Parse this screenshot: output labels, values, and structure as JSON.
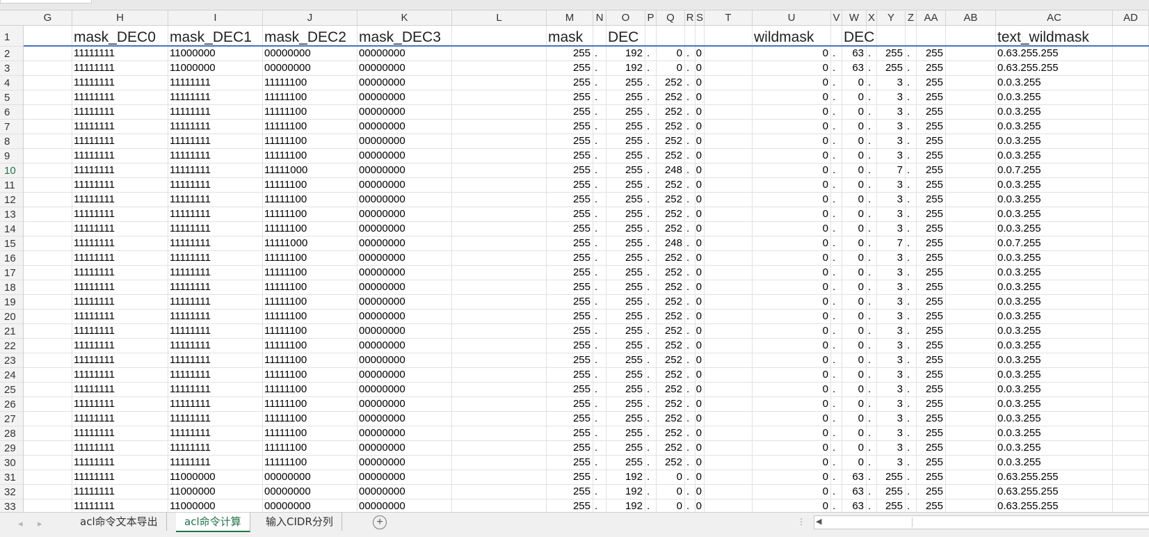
{
  "column_headers": [
    "G",
    "H",
    "I",
    "J",
    "K",
    "L",
    "M",
    "N",
    "O",
    "P",
    "Q",
    "R",
    "S",
    "T",
    "U",
    "V",
    "W",
    "X",
    "Y",
    "Z",
    "AA",
    "AB",
    "AC",
    "AD"
  ],
  "row_numbers": [
    "1",
    "2",
    "3",
    "4",
    "5",
    "6",
    "7",
    "8",
    "9",
    "10",
    "11",
    "12",
    "13",
    "14",
    "15",
    "16",
    "17",
    "18",
    "19",
    "20",
    "21",
    "22",
    "23",
    "24",
    "25",
    "26",
    "27",
    "28",
    "29",
    "30",
    "31",
    "32",
    "33"
  ],
  "selected_row": "10",
  "header_row": {
    "H": "mask_DEC0",
    "I": "mask_DEC1",
    "J": "mask_DEC2",
    "K": "mask_DEC3",
    "M": "mask",
    "O": "DEC",
    "U": "wildmask",
    "W": "DEC",
    "AC": "text_wildmask"
  },
  "rows": [
    {
      "H": "11111111",
      "I": "11000000",
      "J": "00000000",
      "K": "00000000",
      "M": "255",
      "O": "192",
      "Q": "0",
      "S": "0",
      "U": "0",
      "W": "63",
      "Y": "255",
      "AA": "255",
      "AC": "0.63.255.255"
    },
    {
      "H": "11111111",
      "I": "11000000",
      "J": "00000000",
      "K": "00000000",
      "M": "255",
      "O": "192",
      "Q": "0",
      "S": "0",
      "U": "0",
      "W": "63",
      "Y": "255",
      "AA": "255",
      "AC": "0.63.255.255"
    },
    {
      "H": "11111111",
      "I": "11111111",
      "J": "11111100",
      "K": "00000000",
      "M": "255",
      "O": "255",
      "Q": "252",
      "S": "0",
      "U": "0",
      "W": "0",
      "Y": "3",
      "AA": "255",
      "AC": "0.0.3.255"
    },
    {
      "H": "11111111",
      "I": "11111111",
      "J": "11111100",
      "K": "00000000",
      "M": "255",
      "O": "255",
      "Q": "252",
      "S": "0",
      "U": "0",
      "W": "0",
      "Y": "3",
      "AA": "255",
      "AC": "0.0.3.255"
    },
    {
      "H": "11111111",
      "I": "11111111",
      "J": "11111100",
      "K": "00000000",
      "M": "255",
      "O": "255",
      "Q": "252",
      "S": "0",
      "U": "0",
      "W": "0",
      "Y": "3",
      "AA": "255",
      "AC": "0.0.3.255"
    },
    {
      "H": "11111111",
      "I": "11111111",
      "J": "11111100",
      "K": "00000000",
      "M": "255",
      "O": "255",
      "Q": "252",
      "S": "0",
      "U": "0",
      "W": "0",
      "Y": "3",
      "AA": "255",
      "AC": "0.0.3.255"
    },
    {
      "H": "11111111",
      "I": "11111111",
      "J": "11111100",
      "K": "00000000",
      "M": "255",
      "O": "255",
      "Q": "252",
      "S": "0",
      "U": "0",
      "W": "0",
      "Y": "3",
      "AA": "255",
      "AC": "0.0.3.255"
    },
    {
      "H": "11111111",
      "I": "11111111",
      "J": "11111100",
      "K": "00000000",
      "M": "255",
      "O": "255",
      "Q": "252",
      "S": "0",
      "U": "0",
      "W": "0",
      "Y": "3",
      "AA": "255",
      "AC": "0.0.3.255"
    },
    {
      "H": "11111111",
      "I": "11111111",
      "J": "11111000",
      "K": "00000000",
      "M": "255",
      "O": "255",
      "Q": "248",
      "S": "0",
      "U": "0",
      "W": "0",
      "Y": "7",
      "AA": "255",
      "AC": "0.0.7.255"
    },
    {
      "H": "11111111",
      "I": "11111111",
      "J": "11111100",
      "K": "00000000",
      "M": "255",
      "O": "255",
      "Q": "252",
      "S": "0",
      "U": "0",
      "W": "0",
      "Y": "3",
      "AA": "255",
      "AC": "0.0.3.255"
    },
    {
      "H": "11111111",
      "I": "11111111",
      "J": "11111100",
      "K": "00000000",
      "M": "255",
      "O": "255",
      "Q": "252",
      "S": "0",
      "U": "0",
      "W": "0",
      "Y": "3",
      "AA": "255",
      "AC": "0.0.3.255"
    },
    {
      "H": "11111111",
      "I": "11111111",
      "J": "11111100",
      "K": "00000000",
      "M": "255",
      "O": "255",
      "Q": "252",
      "S": "0",
      "U": "0",
      "W": "0",
      "Y": "3",
      "AA": "255",
      "AC": "0.0.3.255"
    },
    {
      "H": "11111111",
      "I": "11111111",
      "J": "11111100",
      "K": "00000000",
      "M": "255",
      "O": "255",
      "Q": "252",
      "S": "0",
      "U": "0",
      "W": "0",
      "Y": "3",
      "AA": "255",
      "AC": "0.0.3.255"
    },
    {
      "H": "11111111",
      "I": "11111111",
      "J": "11111000",
      "K": "00000000",
      "M": "255",
      "O": "255",
      "Q": "248",
      "S": "0",
      "U": "0",
      "W": "0",
      "Y": "7",
      "AA": "255",
      "AC": "0.0.7.255"
    },
    {
      "H": "11111111",
      "I": "11111111",
      "J": "11111100",
      "K": "00000000",
      "M": "255",
      "O": "255",
      "Q": "252",
      "S": "0",
      "U": "0",
      "W": "0",
      "Y": "3",
      "AA": "255",
      "AC": "0.0.3.255"
    },
    {
      "H": "11111111",
      "I": "11111111",
      "J": "11111100",
      "K": "00000000",
      "M": "255",
      "O": "255",
      "Q": "252",
      "S": "0",
      "U": "0",
      "W": "0",
      "Y": "3",
      "AA": "255",
      "AC": "0.0.3.255"
    },
    {
      "H": "11111111",
      "I": "11111111",
      "J": "11111100",
      "K": "00000000",
      "M": "255",
      "O": "255",
      "Q": "252",
      "S": "0",
      "U": "0",
      "W": "0",
      "Y": "3",
      "AA": "255",
      "AC": "0.0.3.255"
    },
    {
      "H": "11111111",
      "I": "11111111",
      "J": "11111100",
      "K": "00000000",
      "M": "255",
      "O": "255",
      "Q": "252",
      "S": "0",
      "U": "0",
      "W": "0",
      "Y": "3",
      "AA": "255",
      "AC": "0.0.3.255"
    },
    {
      "H": "11111111",
      "I": "11111111",
      "J": "11111100",
      "K": "00000000",
      "M": "255",
      "O": "255",
      "Q": "252",
      "S": "0",
      "U": "0",
      "W": "0",
      "Y": "3",
      "AA": "255",
      "AC": "0.0.3.255"
    },
    {
      "H": "11111111",
      "I": "11111111",
      "J": "11111100",
      "K": "00000000",
      "M": "255",
      "O": "255",
      "Q": "252",
      "S": "0",
      "U": "0",
      "W": "0",
      "Y": "3",
      "AA": "255",
      "AC": "0.0.3.255"
    },
    {
      "H": "11111111",
      "I": "11111111",
      "J": "11111100",
      "K": "00000000",
      "M": "255",
      "O": "255",
      "Q": "252",
      "S": "0",
      "U": "0",
      "W": "0",
      "Y": "3",
      "AA": "255",
      "AC": "0.0.3.255"
    },
    {
      "H": "11111111",
      "I": "11111111",
      "J": "11111100",
      "K": "00000000",
      "M": "255",
      "O": "255",
      "Q": "252",
      "S": "0",
      "U": "0",
      "W": "0",
      "Y": "3",
      "AA": "255",
      "AC": "0.0.3.255"
    },
    {
      "H": "11111111",
      "I": "11111111",
      "J": "11111100",
      "K": "00000000",
      "M": "255",
      "O": "255",
      "Q": "252",
      "S": "0",
      "U": "0",
      "W": "0",
      "Y": "3",
      "AA": "255",
      "AC": "0.0.3.255"
    },
    {
      "H": "11111111",
      "I": "11111111",
      "J": "11111100",
      "K": "00000000",
      "M": "255",
      "O": "255",
      "Q": "252",
      "S": "0",
      "U": "0",
      "W": "0",
      "Y": "3",
      "AA": "255",
      "AC": "0.0.3.255"
    },
    {
      "H": "11111111",
      "I": "11111111",
      "J": "11111100",
      "K": "00000000",
      "M": "255",
      "O": "255",
      "Q": "252",
      "S": "0",
      "U": "0",
      "W": "0",
      "Y": "3",
      "AA": "255",
      "AC": "0.0.3.255"
    },
    {
      "H": "11111111",
      "I": "11111111",
      "J": "11111100",
      "K": "00000000",
      "M": "255",
      "O": "255",
      "Q": "252",
      "S": "0",
      "U": "0",
      "W": "0",
      "Y": "3",
      "AA": "255",
      "AC": "0.0.3.255"
    },
    {
      "H": "11111111",
      "I": "11111111",
      "J": "11111100",
      "K": "00000000",
      "M": "255",
      "O": "255",
      "Q": "252",
      "S": "0",
      "U": "0",
      "W": "0",
      "Y": "3",
      "AA": "255",
      "AC": "0.0.3.255"
    },
    {
      "H": "11111111",
      "I": "11111111",
      "J": "11111100",
      "K": "00000000",
      "M": "255",
      "O": "255",
      "Q": "252",
      "S": "0",
      "U": "0",
      "W": "0",
      "Y": "3",
      "AA": "255",
      "AC": "0.0.3.255"
    },
    {
      "H": "11111111",
      "I": "11111111",
      "J": "11111100",
      "K": "00000000",
      "M": "255",
      "O": "255",
      "Q": "252",
      "S": "0",
      "U": "0",
      "W": "0",
      "Y": "3",
      "AA": "255",
      "AC": "0.0.3.255"
    },
    {
      "H": "11111111",
      "I": "11000000",
      "J": "00000000",
      "K": "00000000",
      "M": "255",
      "O": "192",
      "Q": "0",
      "S": "0",
      "U": "0",
      "W": "63",
      "Y": "255",
      "AA": "255",
      "AC": "0.63.255.255"
    },
    {
      "H": "11111111",
      "I": "11000000",
      "J": "00000000",
      "K": "00000000",
      "M": "255",
      "O": "192",
      "Q": "0",
      "S": "0",
      "U": "0",
      "W": "63",
      "Y": "255",
      "AA": "255",
      "AC": "0.63.255.255"
    },
    {
      "H": "11111111",
      "I": "11000000",
      "J": "00000000",
      "K": "00000000",
      "M": "255",
      "O": "192",
      "Q": "0",
      "S": "0",
      "U": "0",
      "W": "63",
      "Y": "255",
      "AA": "255",
      "AC": "0.63.255.255"
    }
  ],
  "dot_separator": ".",
  "sheet_tabs": [
    "acl命令文本导出",
    "acl命令计算",
    "输入CIDR分列"
  ],
  "active_sheet": "acl命令计算",
  "add_sheet_label": "+",
  "nav_prev": "◂",
  "nav_next": "▸",
  "colors": {
    "accent": "#217346",
    "header_underline": "#4472c4"
  }
}
